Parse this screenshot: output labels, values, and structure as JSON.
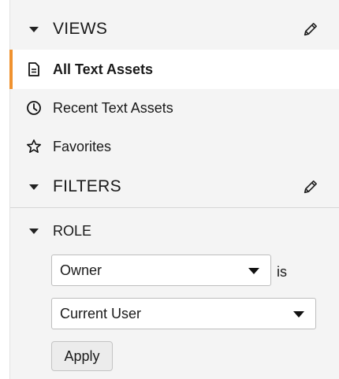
{
  "views": {
    "title": "VIEWS",
    "items": [
      {
        "label": "All Text Assets",
        "icon": "document-icon",
        "active": true
      },
      {
        "label": "Recent Text Assets",
        "icon": "clock-icon",
        "active": false
      },
      {
        "label": "Favorites",
        "icon": "star-icon",
        "active": false
      }
    ]
  },
  "filters": {
    "title": "FILTERS",
    "role": {
      "label": "ROLE",
      "field_value": "Owner",
      "operator": "is",
      "value": "Current User",
      "apply_label": "Apply"
    }
  },
  "colors": {
    "accent": "#f0922f",
    "panel_bg": "#f4f4f4",
    "active_bg": "#ffffff"
  }
}
